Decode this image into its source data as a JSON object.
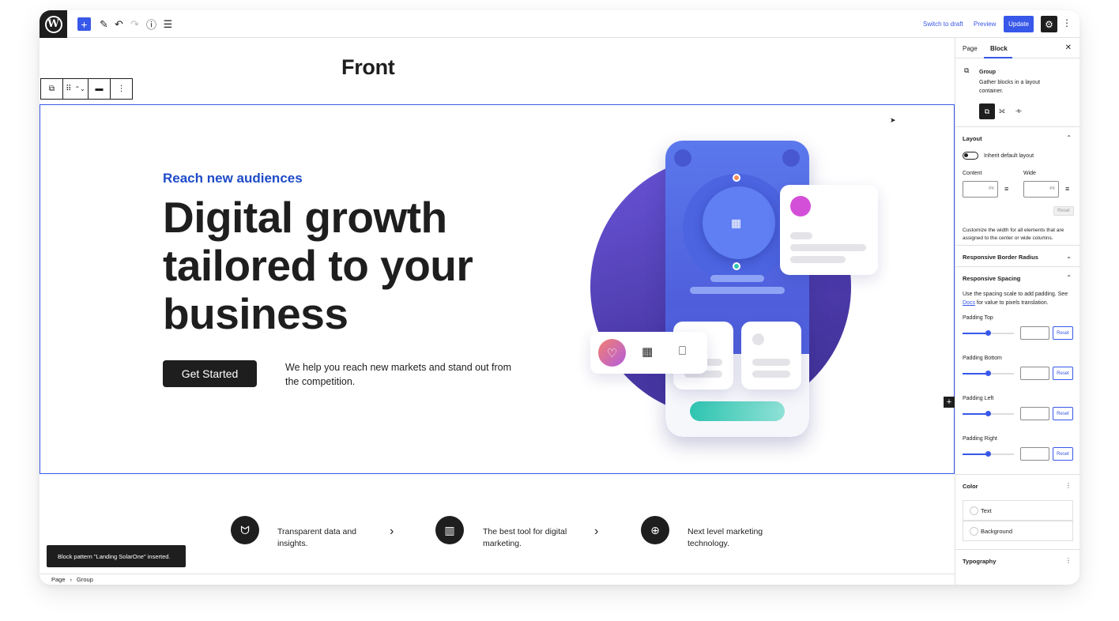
{
  "toolbar": {
    "logo": "W",
    "add_icon": "+",
    "edit_icon": "✎",
    "undo_icon": "↶",
    "redo_icon": "↷",
    "info_icon": "ⓘ",
    "list_icon": "☰",
    "switch_to_draft": "Switch to draft",
    "preview": "Preview",
    "update": "Update",
    "settings_icon": "⚙",
    "more_icon": "⋮",
    "accent_color": "#3858e9"
  },
  "canvas": {
    "page_title": "Front",
    "block_toolbar": {
      "group_icon": "⧉",
      "drag_icon": "⠿",
      "move_icon": "⌃⌄",
      "align_icon": "▬",
      "more_icon": "⋮"
    },
    "hero": {
      "kicker": "Reach new audiences",
      "headline": "Digital growth tailored to your business",
      "cta_label": "Get Started",
      "description": "We help you reach new markets and stand out from the competition."
    },
    "add_block_icon": "+",
    "features": [
      {
        "icon": "ᗢ",
        "text": "Transparent data and insights."
      },
      {
        "icon": "▥",
        "text": "The best tool for digital marketing."
      },
      {
        "icon": "⊕",
        "text": "Next level marketing technology."
      }
    ],
    "arrow_icon": "›",
    "snackbar": "Block pattern \"Landing SolarOne\" inserted.",
    "breadcrumb": {
      "root": "Page",
      "separator": "›",
      "current": "Group"
    }
  },
  "sidebar": {
    "tabs": [
      "Page",
      "Block"
    ],
    "active_tab": "Block",
    "close_icon": "✕",
    "block": {
      "icon": "⧉",
      "name": "Group",
      "description": "Gather blocks in a layout container."
    },
    "variations": [
      "⧉",
      "⟗",
      "⟛"
    ],
    "layout": {
      "title": "Layout",
      "toggle_label": "Inherit default layout",
      "content_label": "Content",
      "wide_label": "Wide",
      "unit": "PX",
      "reset": "Reset",
      "help": "Customize the width for all elements that are assigned to the center or wide columns."
    },
    "border_radius_title": "Responsive Border Radius",
    "spacing": {
      "title": "Responsive Spacing",
      "help_pre": "Use the spacing scale to add padding. See ",
      "help_link": "Docs",
      "help_post": " for value to pixels translation.",
      "items": [
        {
          "label": "Padding Top",
          "value": 0.5,
          "reset": "Reset"
        },
        {
          "label": "Padding Bottom",
          "value": 0.5,
          "reset": "Reset"
        },
        {
          "label": "Padding Left",
          "value": 0.5,
          "reset": "Reset"
        },
        {
          "label": "Padding Right",
          "value": 0.5,
          "reset": "Reset"
        }
      ]
    },
    "color": {
      "title": "Color",
      "items": [
        "Text",
        "Background"
      ]
    },
    "typography_title": "Typography"
  }
}
